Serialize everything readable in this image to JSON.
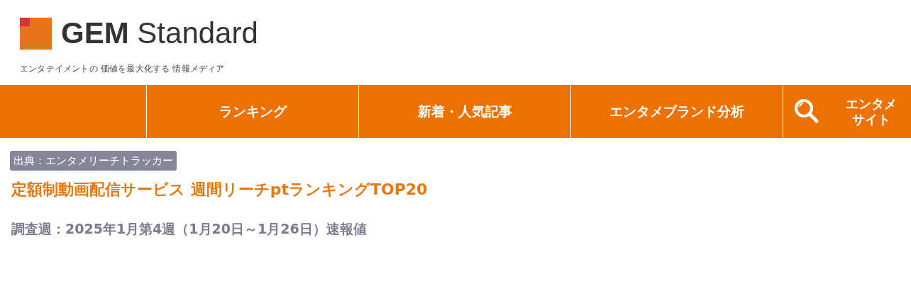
{
  "logo": {
    "brand_bold": "GEM",
    "brand_light": "Standard",
    "tagline": "エンタテイメントの 価値を最大化する 情報メディア"
  },
  "nav": {
    "items": [
      {
        "label": "ランキング",
        "kind": "link"
      },
      {
        "label": "新着・人気記事",
        "kind": "link"
      },
      {
        "label": "エンタメブランド分析",
        "kind": "link"
      },
      {
        "lines": [
          "エンタメ",
          "サイト"
        ],
        "kind": "search"
      }
    ]
  },
  "article": {
    "source_badge": "出典：エンタメリーチトラッカー",
    "title": "定額制動画配信サービス 週間リーチptランキングTOP20",
    "survey_week": "調査週：2025年1月第4週（1月20日～1月26日）速報値"
  }
}
